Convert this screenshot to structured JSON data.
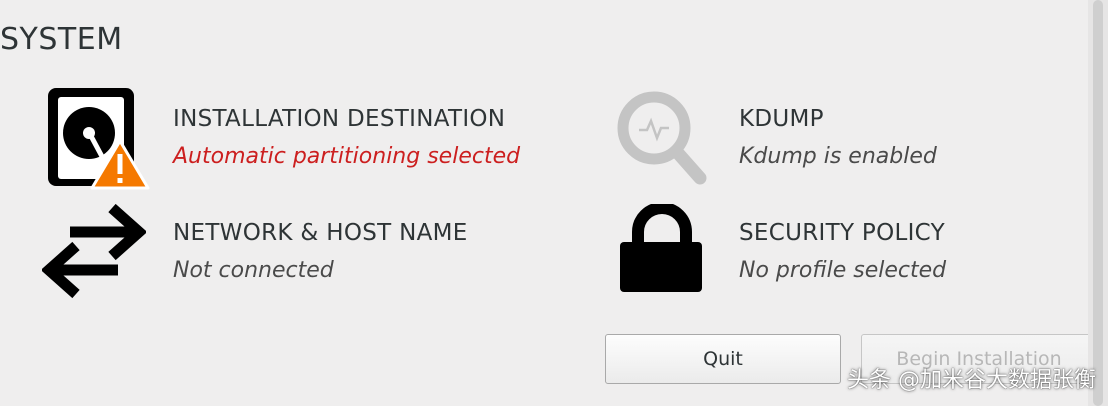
{
  "section": {
    "title": "SYSTEM"
  },
  "spokes": [
    {
      "title": "INSTALLATION DESTINATION",
      "status": "Automatic partitioning selected",
      "icon": "hard-drive-warning-icon",
      "warning": true
    },
    {
      "title": "KDUMP",
      "status": "Kdump is enabled",
      "icon": "kdump-magnifier-icon",
      "warning": false
    },
    {
      "title": "NETWORK & HOST NAME",
      "status": "Not connected",
      "icon": "network-arrows-icon",
      "warning": false
    },
    {
      "title": "SECURITY POLICY",
      "status": "No profile selected",
      "icon": "lock-icon",
      "warning": false
    }
  ],
  "buttons": {
    "quit": "Quit",
    "begin": "Begin Installation"
  },
  "watermark": "头条 @加米谷大数据张衡",
  "colors": {
    "warning_text": "#cc1f1f",
    "warning_badge": "#f57900",
    "background": "#efeeee"
  }
}
